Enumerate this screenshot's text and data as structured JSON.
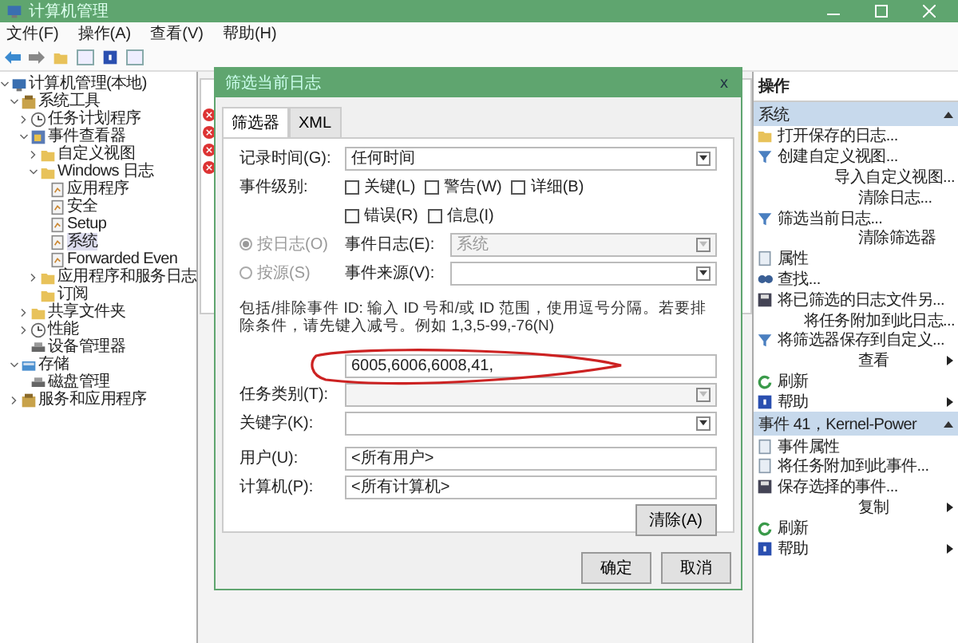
{
  "window": {
    "title": "计算机管理"
  },
  "menu": [
    "文件(F)",
    "操作(A)",
    "查看(V)",
    "帮助(H)"
  ],
  "tree": [
    {
      "label": "计算机管理(本地)",
      "selected": false,
      "expanded": true,
      "children": [
        {
          "label": "系统工具",
          "selected": false,
          "expanded": true,
          "children": [
            {
              "label": "任务计划程序",
              "selected": false,
              "expanded": false
            },
            {
              "label": "事件查看器",
              "selected": false,
              "expanded": true,
              "children": [
                {
                  "label": "自定义视图",
                  "selected": false,
                  "expanded": false
                },
                {
                  "label": "Windows 日志",
                  "selected": false,
                  "expanded": true,
                  "children": [
                    {
                      "label": "应用程序",
                      "selected": false
                    },
                    {
                      "label": "安全",
                      "selected": false
                    },
                    {
                      "label": "Setup",
                      "selected": false
                    },
                    {
                      "label": "系统",
                      "selected": true
                    },
                    {
                      "label": "Forwarded Even",
                      "selected": false
                    }
                  ]
                },
                {
                  "label": "应用程序和服务日志",
                  "selected": false,
                  "expanded": false
                },
                {
                  "label": "订阅",
                  "selected": false
                }
              ]
            },
            {
              "label": "共享文件夹",
              "selected": false,
              "expanded": false
            },
            {
              "label": "性能",
              "selected": false,
              "expanded": false
            },
            {
              "label": "设备管理器",
              "selected": false
            }
          ]
        },
        {
          "label": "存储",
          "selected": false,
          "expanded": true,
          "children": [
            {
              "label": "磁盘管理",
              "selected": false
            }
          ]
        },
        {
          "label": "服务和应用程序",
          "selected": false,
          "expanded": false
        }
      ]
    }
  ],
  "actions": {
    "title": "操作",
    "sections": [
      {
        "title": "系统",
        "items": [
          {
            "label": "打开保存的日志...",
            "submenu": false
          },
          {
            "label": "创建自定义视图...",
            "submenu": false
          },
          {
            "label": "导入自定义视图...",
            "submenu": false
          },
          {
            "label": "清除日志...",
            "submenu": false
          },
          {
            "label": "筛选当前日志...",
            "submenu": false
          },
          {
            "label": "清除筛选器",
            "submenu": false
          },
          {
            "label": "属性",
            "submenu": false
          },
          {
            "label": "查找...",
            "submenu": false
          },
          {
            "label": "将已筛选的日志文件另...",
            "submenu": false
          },
          {
            "label": "将任务附加到此日志...",
            "submenu": false
          },
          {
            "label": "将筛选器保存到自定义...",
            "submenu": false
          },
          {
            "label": "查看",
            "submenu": true
          },
          {
            "label": "刷新",
            "submenu": false
          },
          {
            "label": "帮助",
            "submenu": true
          }
        ]
      },
      {
        "title": "事件 41，Kernel-Power",
        "items": [
          {
            "label": "事件属性",
            "submenu": false
          },
          {
            "label": "将任务附加到此事件...",
            "submenu": false
          },
          {
            "label": "保存选择的事件...",
            "submenu": false
          },
          {
            "label": "复制",
            "submenu": true
          },
          {
            "label": "刷新",
            "submenu": false
          },
          {
            "label": "帮助",
            "submenu": true
          }
        ]
      }
    ]
  },
  "dialog": {
    "title": "筛选当前日志",
    "close": "x",
    "tabs": [
      {
        "label": "筛选器",
        "selected": true
      },
      {
        "label": "XML",
        "selected": false
      }
    ],
    "logged": {
      "label": "记录时间(G):",
      "value": "任何时间"
    },
    "level": {
      "label": "事件级别:",
      "options": [
        {
          "label": "关键(L)",
          "checked": false
        },
        {
          "label": "警告(W)",
          "checked": false
        },
        {
          "label": "详细(B)",
          "checked": false
        },
        {
          "label": "错误(R)",
          "checked": false
        },
        {
          "label": "信息(I)",
          "checked": false
        }
      ]
    },
    "by_log": {
      "label": "按日志(O)",
      "selected": true,
      "disabled": true,
      "field_label": "事件日志(E):",
      "value": "系统"
    },
    "by_source": {
      "label": "按源(S)",
      "selected": false,
      "disabled": true,
      "field_label": "事件来源(V):"
    },
    "id_help": "包括/排除事件 ID: 输入 ID 号和/或 ID 范围，使用逗号分隔。若要排除条件，请先键入减号。例如 1,3,5-99,-76(N)",
    "event_ids": "6005,6006,6008,41,",
    "task_category": {
      "label": "任务类别(T):",
      "disabled": true
    },
    "keywords": {
      "label": "关键字(K):",
      "disabled": false
    },
    "user": {
      "label": "用户(U):",
      "value": "<所有用户>"
    },
    "computer": {
      "label": "计算机(P):",
      "value": "<所有计算机>"
    },
    "clear": "清除(A)",
    "ok": "确定",
    "cancel": "取消"
  }
}
